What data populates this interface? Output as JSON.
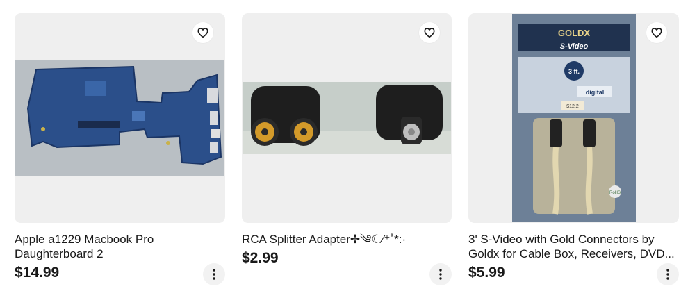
{
  "listings": [
    {
      "title": "Apple a1229 Macbook Pro Daughterboard 2",
      "price": "$14.99",
      "image_icon": "logic-board-photo"
    },
    {
      "title": "RCA Splitter Adapter✢༄☾⁄⁺˚*:·",
      "price": "$2.99",
      "image_icon": "rca-adapter-photo"
    },
    {
      "title": "3' S-Video with Gold Connectors by Goldx for Cable Box, Receivers, DVD...",
      "price": "$5.99",
      "image_icon": "svideo-cable-package-photo",
      "package_text": {
        "brand": "GOLDX",
        "product": "S-Video",
        "length": "3 ft.",
        "sticker": "$12.2",
        "badge": "digital",
        "rohs": "RoHS"
      }
    }
  ],
  "colors": {
    "card_bg": "#efefef",
    "text": "#191919",
    "button_bg": "#f2f2f2"
  }
}
